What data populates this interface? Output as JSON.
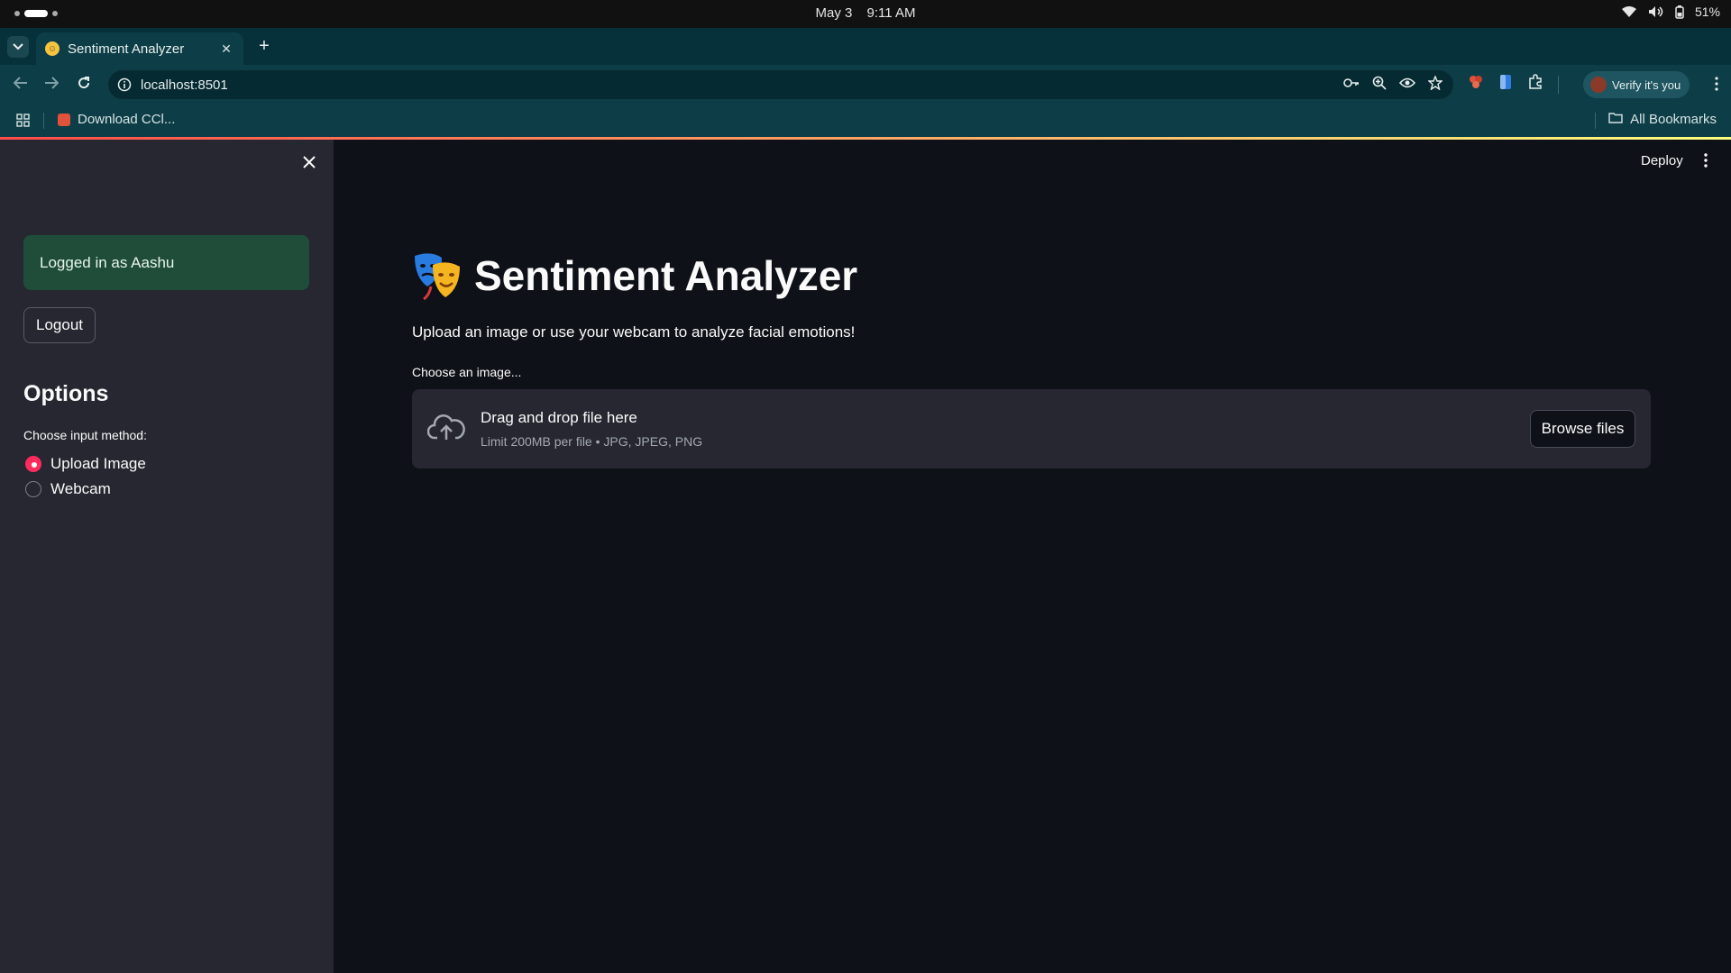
{
  "os": {
    "date": "May 3",
    "time": "9:11 AM",
    "battery": "51%"
  },
  "browser": {
    "tab_title": "Sentiment Analyzer",
    "url": "localhost:8501",
    "verify_label": "Verify it's you",
    "bookmark_1": "Download CCl...",
    "all_bookmarks": "All Bookmarks"
  },
  "app": {
    "deploy_label": "Deploy",
    "title": "Sentiment Analyzer",
    "subtitle": "Upload an image or use your webcam to analyze facial emotions!"
  },
  "sidebar": {
    "login_status": "Logged in as Aashu",
    "logout_label": "Logout",
    "options_title": "Options",
    "radio_label": "Choose input method:",
    "radio_options": [
      {
        "label": "Upload Image",
        "selected": true
      },
      {
        "label": "Webcam",
        "selected": false
      }
    ]
  },
  "uploader": {
    "label": "Choose an image...",
    "drop_title": "Drag and drop file here",
    "drop_limit": "Limit 200MB per file • JPG, JPEG, PNG",
    "browse_label": "Browse files"
  },
  "colors": {
    "accent": "#ff2b5e",
    "success_bg": "#1f4d3a",
    "sidebar_bg": "#262730",
    "main_bg": "#0e1117"
  }
}
